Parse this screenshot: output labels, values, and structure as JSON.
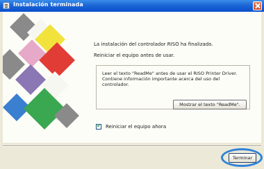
{
  "window": {
    "title": "Instalación terminada",
    "title_icon": "installer-icon",
    "close_icon": "close-icon"
  },
  "main": {
    "message_finished": "La instalación del controlador RISO ha finalizado.",
    "message_restart": "Reiniciar el equipo antes de usar.",
    "readme_text": "Leer el texto \"ReadMe\" antes de usar el RISO Printer Driver. Contiene información importante acerca del uso del controlador.",
    "readme_button": "Mostrar el texto \"ReadMe\".",
    "restart_checkbox_label": "Reiniciar el equipo ahora",
    "restart_checked": true
  },
  "footer": {
    "finish_button": "Terminar"
  },
  "colors": {
    "titlebar": "#0a4fcd",
    "highlight_ring": "#2f82d8",
    "art_yellow": "#f2e33c",
    "art_red": "#e13c36",
    "art_pink": "#e7a9c8",
    "art_purple": "#8a77b3",
    "art_green": "#3aa850",
    "art_gray": "#8a8a8a",
    "art_blue": "#3b7fd0"
  }
}
